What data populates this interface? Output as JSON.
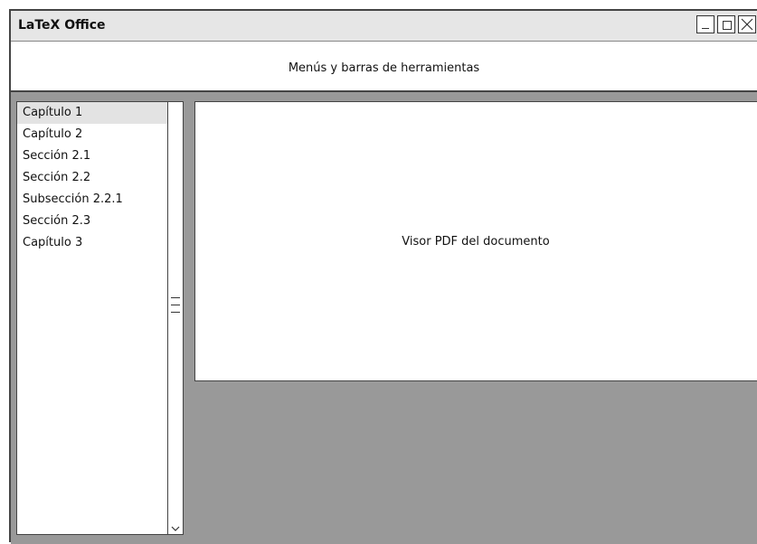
{
  "window": {
    "title": "LaTeX Office",
    "controls": [
      "minimize-icon",
      "maximize-icon",
      "close-icon"
    ]
  },
  "toolbar": {
    "label": "Menús y barras de herramientas"
  },
  "sidebar": {
    "items": [
      {
        "label": "Capítulo 1",
        "selected": true
      },
      {
        "label": "Capítulo 2",
        "selected": false
      },
      {
        "label": "Sección 2.1",
        "selected": false
      },
      {
        "label": "Sección 2.2",
        "selected": false
      },
      {
        "label": "Subsección 2.2.1",
        "selected": false
      },
      {
        "label": "Sección 2.3",
        "selected": false
      },
      {
        "label": "Capítulo 3",
        "selected": false
      }
    ]
  },
  "viewer": {
    "label": "Visor PDF del documento"
  },
  "colors": {
    "workspace_bg": "#999999",
    "titlebar_bg": "#e6e6e6",
    "selection_bg": "#e3e3e3",
    "border": "#444444"
  }
}
